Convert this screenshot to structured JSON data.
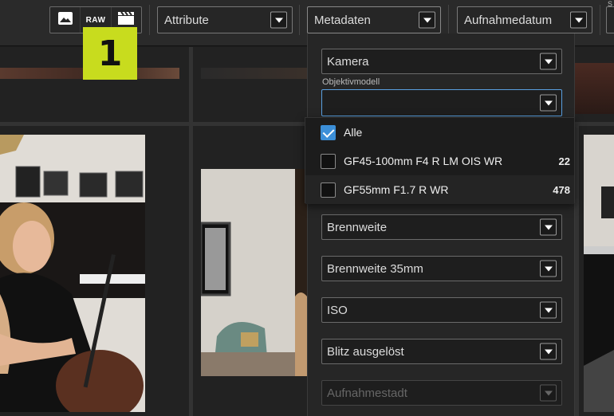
{
  "toolbar": {
    "type_buttons": [
      {
        "name": "image-icon"
      },
      {
        "label": "RAW"
      },
      {
        "name": "clapperboard-icon"
      }
    ],
    "filters": [
      {
        "label": "Attribute"
      },
      {
        "label": "Metadaten"
      },
      {
        "label": "Aufnahmedatum"
      }
    ],
    "edge_text": "S"
  },
  "badge": {
    "number": "1"
  },
  "metadata_panel": {
    "fields": {
      "kamera": "Kamera",
      "objektiv_label": "Objektivmodell",
      "objektiv_value": "",
      "brennweite": "Brennweite",
      "brennweite35": "Brennweite 35mm",
      "iso": "ISO",
      "blitz": "Blitz ausgelöst",
      "aufnahmestadt": "Aufnahmestadt"
    },
    "options": [
      {
        "label": "Alle",
        "count": "",
        "checked": true
      },
      {
        "label": "GF45-100mm F4 R LM OIS WR",
        "count": "22",
        "checked": false
      },
      {
        "label": "GF55mm F1.7 R WR",
        "count": "478",
        "checked": false
      }
    ]
  },
  "colors": {
    "accent": "#3c8fd8",
    "badge": "#c8dc1e"
  }
}
